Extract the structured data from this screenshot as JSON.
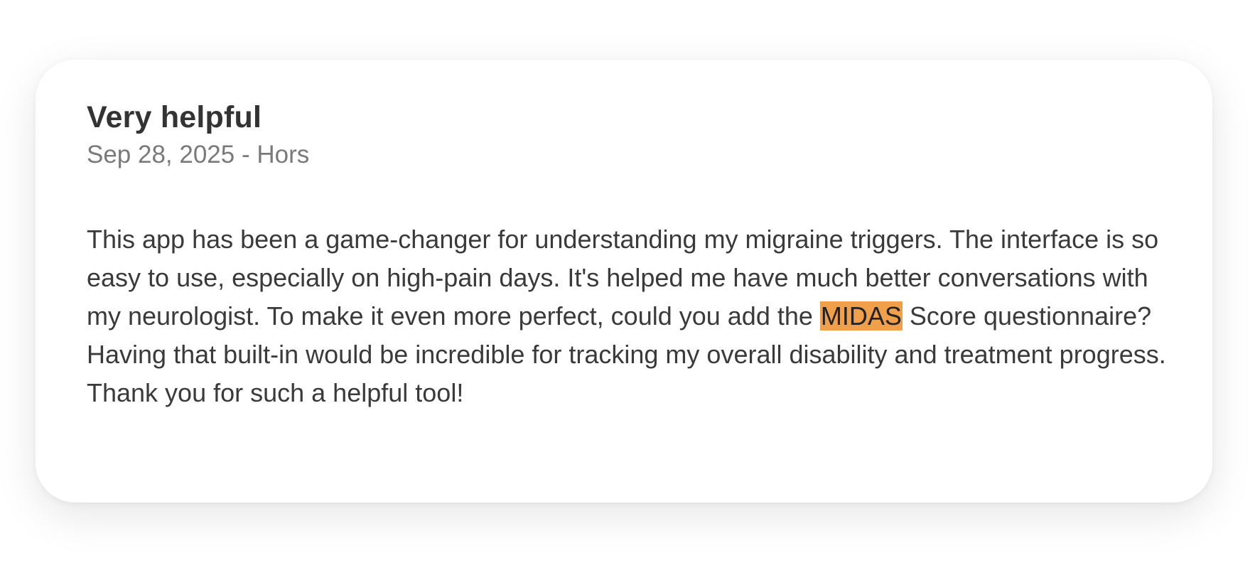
{
  "review": {
    "title": "Very helpful",
    "date": "Sep 28, 2025",
    "separator": "-",
    "author": "Hors",
    "body_before": "This app has been a game-changer for understanding my migraine triggers. The interface is so easy to use, especially on high-pain days. It's helped me have much better conversations with my neurologist. To make it even more perfect, could you add the ",
    "body_highlight": "MIDAS",
    "body_after": " Score questionnaire? Having that built-in would be incredible for tracking my overall disability and treatment progress. Thank you for such a helpful tool!"
  },
  "colors": {
    "highlight": "#f0a04b",
    "title": "#333333",
    "meta": "#7a7a7a",
    "body": "#3a3a3a"
  }
}
